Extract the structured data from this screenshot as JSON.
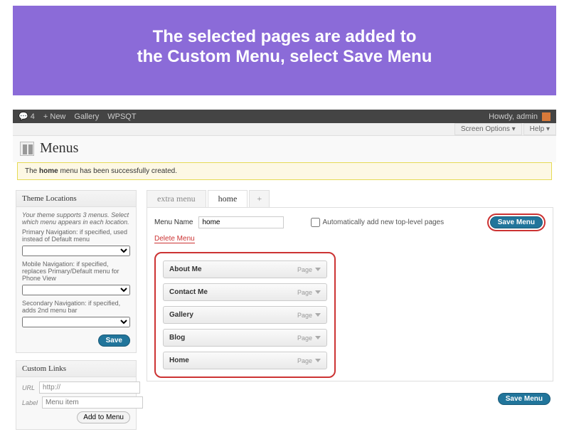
{
  "banner": {
    "line1": "The selected pages are added to",
    "line2": "the Custom Menu, select Save Menu"
  },
  "adminbar": {
    "comments": "4",
    "new": "+ New",
    "gallery": "Gallery",
    "wpsqt": "WPSQT",
    "howdy": "Howdy, admin"
  },
  "screen_tabs": {
    "options": "Screen Options ▾",
    "help": "Help ▾"
  },
  "page_title": "Menus",
  "notice": {
    "pre": "The ",
    "bold": "home",
    "post": " menu has been successfully created."
  },
  "theme_locations": {
    "title": "Theme Locations",
    "intro": "Your theme supports 3 menus. Select which menu appears in each location.",
    "primary": "Primary Navigation: if specified, used instead of Default menu",
    "mobile": "Mobile Navigation: if specified, replaces Primary/Default menu for Phone View",
    "secondary": "Secondary Navigation: if specified, adds 2nd menu bar",
    "save": "Save"
  },
  "custom_links": {
    "title": "Custom Links",
    "url_label": "URL",
    "url_value": "http://",
    "label_label": "Label",
    "label_placeholder": "Menu item",
    "add": "Add to Menu"
  },
  "tabs": {
    "extra": "extra menu",
    "home": "home",
    "add": "+"
  },
  "menu": {
    "name_label": "Menu Name",
    "name_value": "home",
    "auto_label": "Automatically add new top-level pages",
    "delete": "Delete Menu",
    "save": "Save Menu",
    "items": [
      {
        "title": "About Me",
        "type": "Page"
      },
      {
        "title": "Contact Me",
        "type": "Page"
      },
      {
        "title": "Gallery",
        "type": "Page"
      },
      {
        "title": "Blog",
        "type": "Page"
      },
      {
        "title": "Home",
        "type": "Page"
      }
    ]
  }
}
